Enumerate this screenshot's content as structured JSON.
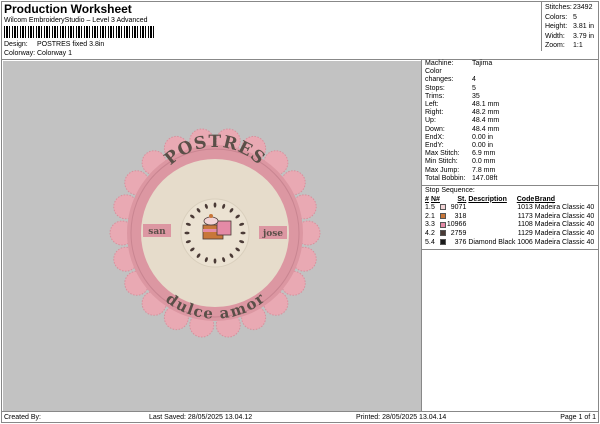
{
  "header": {
    "title": "Production Worksheet",
    "software": "Wilcom EmbroideryStudio – Level 3 Advanced",
    "design_label": "Design:",
    "design_value": "POSTRES fixed 3.8in",
    "colorway_label": "Colorway:",
    "colorway_value": "Colorway 1"
  },
  "stats": [
    {
      "k": "Stitches:",
      "v": "23492"
    },
    {
      "k": "Colors:",
      "v": "5"
    },
    {
      "k": "Height:",
      "v": "3.81 in"
    },
    {
      "k": "Width:",
      "v": "3.79 in"
    },
    {
      "k": "Zoom:",
      "v": "1:1"
    }
  ],
  "info": [
    {
      "k": "Machine:",
      "v": "Tajima"
    },
    {
      "k": "Color changes:",
      "v": "4"
    },
    {
      "k": "Stops:",
      "v": "5"
    },
    {
      "k": "Trims:",
      "v": "35"
    },
    {
      "k": "Left:",
      "v": "48.1 mm"
    },
    {
      "k": "Right:",
      "v": "48.2 mm"
    },
    {
      "k": "Up:",
      "v": "48.4 mm"
    },
    {
      "k": "Down:",
      "v": "48.4 mm"
    },
    {
      "k": "EndX:",
      "v": "0.00 in"
    },
    {
      "k": "EndY:",
      "v": "0.00 in"
    },
    {
      "k": "Max Stitch:",
      "v": "6.9 mm"
    },
    {
      "k": "Min Stitch:",
      "v": "0.0 mm"
    },
    {
      "k": "Max Jump:",
      "v": "7.8 mm"
    },
    {
      "k": "Total Bobbin:",
      "v": "147.08ft"
    }
  ],
  "sequence": {
    "title": "Stop Sequence:",
    "headers": [
      "#",
      "N#",
      "St.",
      "Description",
      "Code",
      "Brand"
    ],
    "rows": [
      {
        "n": "1.",
        "nn": "5",
        "color": "#f2d4d6",
        "st": "9071",
        "desc": "",
        "code": "1013",
        "brand": "Madeira Classic 40"
      },
      {
        "n": "2.",
        "nn": "1",
        "color": "#c8773a",
        "st": "318",
        "desc": "",
        "code": "1173",
        "brand": "Madeira Classic 40"
      },
      {
        "n": "3.",
        "nn": "3",
        "color": "#e48aa6",
        "st": "10966",
        "desc": "",
        "code": "1108",
        "brand": "Madeira Classic 40"
      },
      {
        "n": "4.",
        "nn": "2",
        "color": "#4a3a36",
        "st": "2759",
        "desc": "",
        "code": "1129",
        "brand": "Madeira Classic 40"
      },
      {
        "n": "5.",
        "nn": "4",
        "color": "#1a1a1a",
        "st": "376",
        "desc": "Diamond Black",
        "code": "1006",
        "brand": "Madeira Classic 40"
      }
    ]
  },
  "design": {
    "top_text": "POSTRES",
    "bottom_text": "dulce amor",
    "left_text": "san",
    "right_text": "jose",
    "colors": {
      "lace": "#e9a9b3",
      "band": "#dc97a2",
      "fill": "#e6dccb",
      "text": "#5a4f48"
    }
  },
  "footer": {
    "created": "Created By:",
    "saved": "Last Saved: 28/05/2025 13.04.12",
    "printed": "Printed: 28/05/2025 13.04.14",
    "page": "Page 1 of 1"
  }
}
